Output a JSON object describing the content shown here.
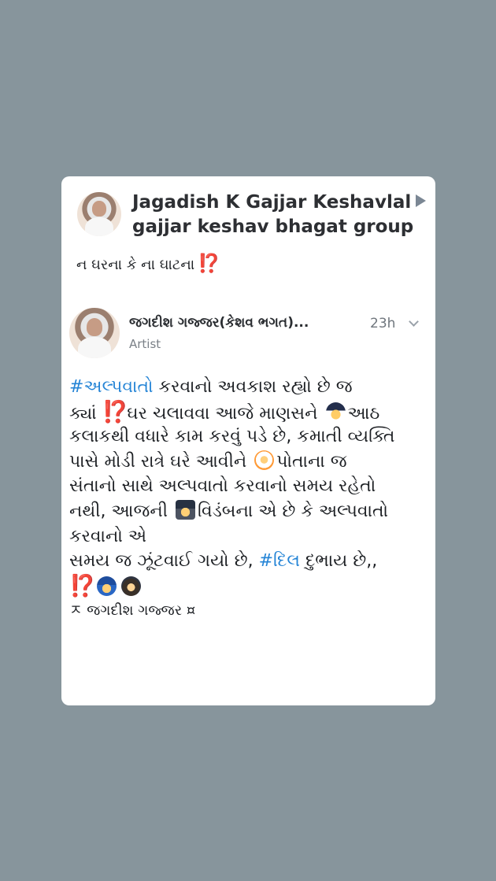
{
  "share": {
    "sharer_name": "Jagadish K Gajjar Keshavlal",
    "group_name": "gajjar keshav bhagat group",
    "caption_text": "ન ઘરના કે ના ઘાટના",
    "caption_emoji": "⁉️"
  },
  "post": {
    "author_name": "જગદીશ ગજ્જર(કેશવ ભગત)...",
    "author_role": "Artist",
    "time": "23h",
    "body": {
      "l1_hashtag": "#અલ્પવાતો",
      "l1_text": " કરવાનો અવકાશ રહ્યો છે જ",
      "l2_a": "ક્યાં ",
      "l2_qe": "⁉️",
      "l2_b": "ઘર ચલાવવા આજે માણસને ",
      "l2_c": "આઠ",
      "l3": "કલાકથી વધારે કામ કરવું પડે છે, કમાતી વ્યક્તિ",
      "l4_a": "પાસે મોડી રાત્રે ઘરે આવીને ",
      "l4_b": "પોતાના જ",
      "l5": "સંતાનો સાથે અલ્પવાતો કરવાનો સમય રહેતો",
      "l6_a": "નથી, આજની ",
      "l6_b": "વિડંબના એ છે કે અલ્પવાતો",
      "l7": "કરવાનો એ",
      "l8_a": "સમય જ ઝૂંટવાઈ ગયો છે, ",
      "l8_hashtag": "#દિલ",
      "l8_b": " દુભાય છે,,",
      "l9_qe": "⁉️",
      "signature": "ㅈ જગદીશ ગજ્જર ¤"
    }
  },
  "icons": {
    "share_arrow": "arrow-right-icon",
    "menu": "chevron-down-icon",
    "emoji_1": "man-pilot-icon",
    "emoji_2": "astronaut-icon",
    "emoji_3": "graduate-icon",
    "emoji_4": "police-officer-icon",
    "emoji_5": "woman-icon"
  },
  "colors": {
    "background": "#87959c",
    "card": "#ffffff",
    "hashtag": "#2484d6",
    "question_exclamation": "#e4372d"
  }
}
